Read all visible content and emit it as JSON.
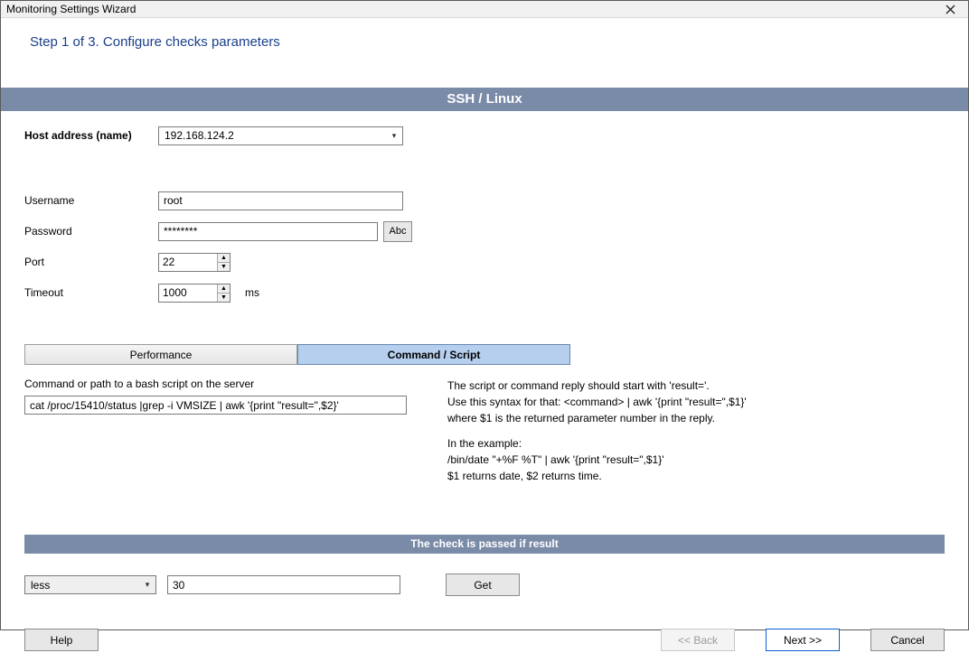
{
  "window": {
    "title": "Monitoring Settings Wizard",
    "step_text": "Step 1 of 3. Configure checks parameters"
  },
  "section": {
    "title": "SSH / Linux"
  },
  "fields": {
    "host_label": "Host address (name)",
    "host_value": "192.168.124.2",
    "username_label": "Username",
    "username_value": "root",
    "password_label": "Password",
    "password_value": "********",
    "abc_label": "Abc",
    "port_label": "Port",
    "port_value": "22",
    "timeout_label": "Timeout",
    "timeout_value": "1000",
    "timeout_unit": "ms"
  },
  "tabs": {
    "performance": "Performance",
    "command": "Command / Script"
  },
  "command": {
    "label": "Command or path to a bash script on the server",
    "value": "cat /proc/15410/status |grep -i VMSIZE | awk '{print \"result=\",$2}'"
  },
  "help_text": {
    "l1": "The script or command reply should start with 'result='.",
    "l2": "Use this syntax for that: <command> | awk '{print \"result=\",$1}'",
    "l3": "where $1 is the returned parameter number in the reply.",
    "l4": "In the example:",
    "l5": "/bin/date \"+%F %T\" | awk '{print \"result=\",$1}'",
    "l6": "$1 returns date, $2 returns time."
  },
  "check": {
    "header": "The check is passed if result",
    "condition": "less",
    "value": "30",
    "get_label": "Get"
  },
  "footer": {
    "help": "Help",
    "back": "<< Back",
    "next": "Next >>",
    "cancel": "Cancel"
  }
}
